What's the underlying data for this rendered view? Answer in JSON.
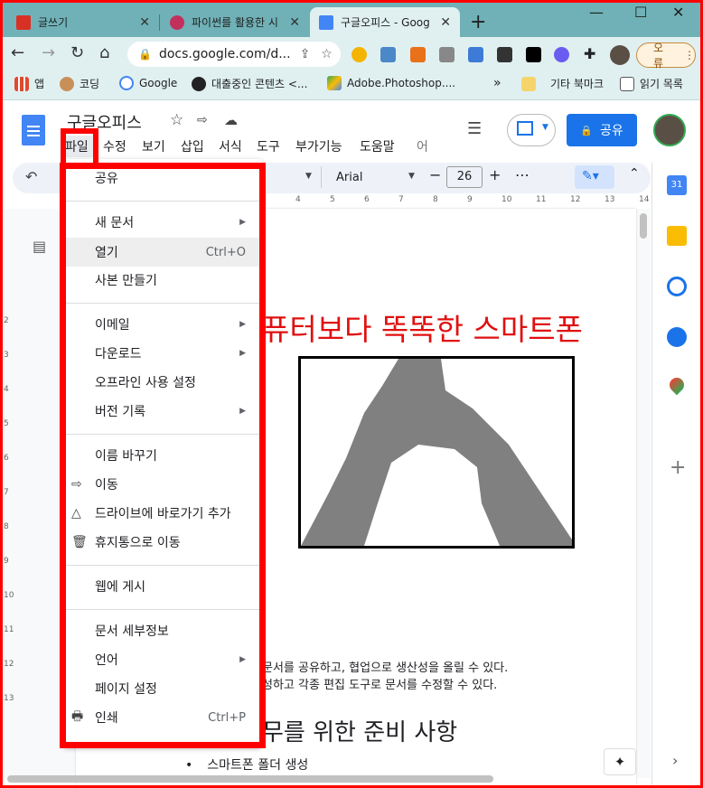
{
  "browser": {
    "tabs": [
      {
        "title": "글쓰기",
        "color": "#d93025"
      },
      {
        "title": "파이썬를 활용한 시",
        "color": "#c4305c"
      },
      {
        "title": "구글오피스 - Goog",
        "color": "#4285f4"
      }
    ],
    "new_tab": "+",
    "url": "docs.google.com/d...",
    "profile_label": "오류",
    "bookmarks": [
      "앱",
      "코딩",
      "Google",
      "대출중인 콘텐츠 <...",
      "Adobe.Photoshop....",
      "기타 북마크",
      "읽기 목록"
    ],
    "more_bookmarks": "»"
  },
  "docs": {
    "title": "구글오피스",
    "menus": [
      "파일",
      "수정",
      "보기",
      "삽입",
      "서식",
      "도구",
      "부가기능",
      "도움말",
      "어"
    ],
    "share_label": "공유",
    "font_name": "Arial",
    "font_size": "26",
    "ruler_ticks": [
      "4",
      "5",
      "6",
      "7",
      "8",
      "9",
      "10",
      "11",
      "12",
      "13",
      "14"
    ],
    "vruler_ticks": [
      "2",
      "3",
      "4",
      "5",
      "6",
      "7",
      "8",
      "9",
      "10",
      "11",
      "12",
      "13"
    ]
  },
  "document": {
    "heading_fragment": "퓨터보다 똑똑한 스마트폰",
    "line1": "문서를 공유하고, 협업으로 생산성을 올릴 수 있다.",
    "line2": "성하고 각종 편집 도구로 문서를 수정할 수 있다.",
    "section_title": "무를 위한 준비 사항",
    "bullet": "스마트폰 폴더 생성"
  },
  "file_menu": {
    "share": "공유",
    "new_doc": "새 문서",
    "open": "열기",
    "open_shortcut": "Ctrl+O",
    "make_copy": "사본 만들기",
    "email": "이메일",
    "download": "다운로드",
    "offline": "오프라인 사용 설정",
    "version": "버전 기록",
    "rename": "이름 바꾸기",
    "move": "이동",
    "add_shortcut": "드라이브에 바로가기 추가",
    "trash": "휴지통으로 이동",
    "publish": "웹에 게시",
    "details": "문서 세부정보",
    "language": "언어",
    "page_setup": "페이지 설정",
    "print": "인쇄",
    "print_shortcut": "Ctrl+P"
  },
  "colors": {
    "accent": "#1a73e8",
    "annotation": "#ff0000",
    "heading": "#e01010",
    "tabbar": "#6fb1b7"
  }
}
